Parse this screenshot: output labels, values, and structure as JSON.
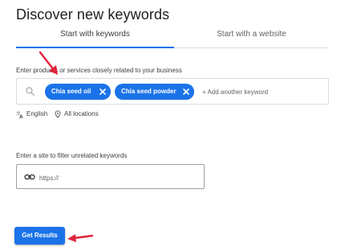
{
  "title": "Discover new keywords",
  "tabs": [
    {
      "label": "Start with keywords",
      "active": true
    },
    {
      "label": "Start with a website",
      "active": false
    }
  ],
  "keywords": {
    "label": "Enter products or services closely related to your business",
    "chips": [
      "Chia seed oil",
      "Chia seed powder"
    ],
    "placeholder": "+ Add another keyword"
  },
  "settings": {
    "language": "English",
    "location": "All locations"
  },
  "site_filter": {
    "label": "Enter a site to filter unrelated keywords",
    "placeholder": "https://"
  },
  "submit_label": "Get Results",
  "colors": {
    "accent": "#1a73e8",
    "annotation_arrow": "#e0243c"
  },
  "icons": [
    "search-icon",
    "close-icon",
    "translate-icon",
    "location-pin-icon",
    "link-icon",
    "red-arrow-annotation"
  ]
}
